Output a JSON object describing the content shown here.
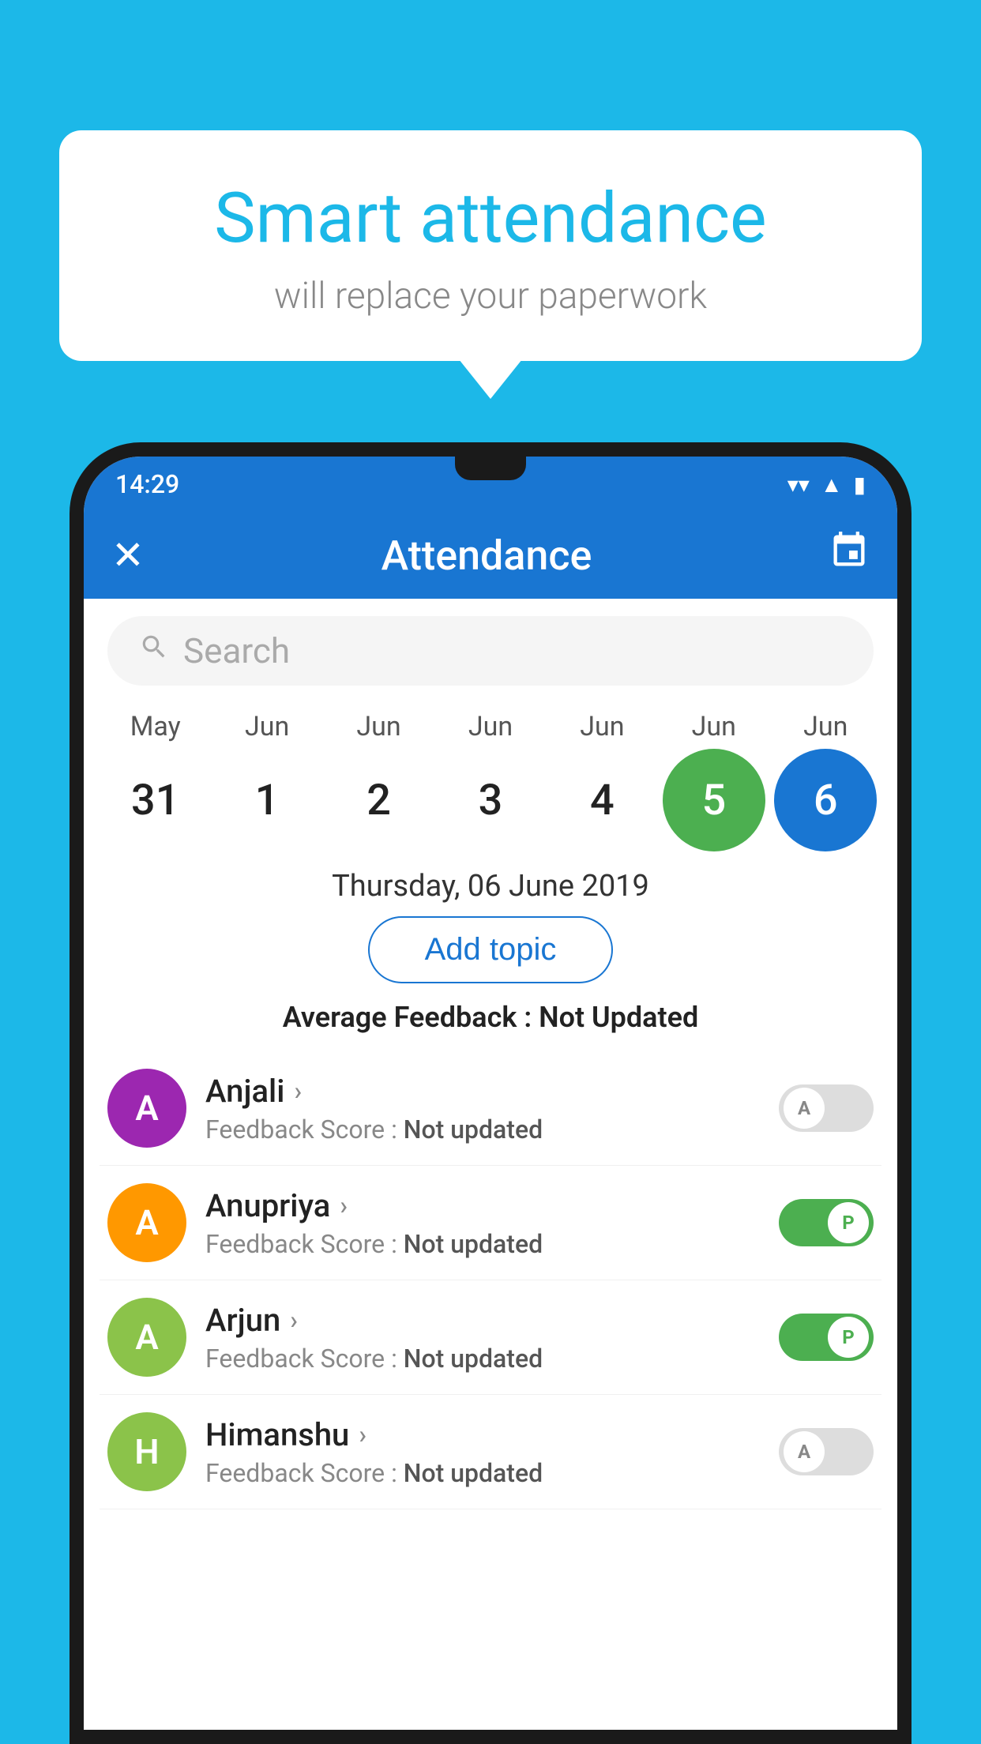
{
  "background_color": "#1cb8e8",
  "bubble": {
    "title": "Smart attendance",
    "subtitle": "will replace your paperwork"
  },
  "status_bar": {
    "time": "14:29",
    "wifi_icon": "▲",
    "signal_icon": "▲",
    "battery_icon": "▮"
  },
  "app_bar": {
    "close_icon": "✕",
    "title": "Attendance",
    "calendar_icon": "📅"
  },
  "search": {
    "placeholder": "Search",
    "icon": "🔍"
  },
  "calendar": {
    "months": [
      "May",
      "Jun",
      "Jun",
      "Jun",
      "Jun",
      "Jun",
      "Jun"
    ],
    "dates": [
      "31",
      "1",
      "2",
      "3",
      "4",
      "5",
      "6"
    ],
    "today_index": 5,
    "selected_index": 6
  },
  "selected_date_label": "Thursday, 06 June 2019",
  "add_topic_label": "Add topic",
  "feedback_summary": {
    "label": "Average Feedback : ",
    "value": "Not Updated"
  },
  "students": [
    {
      "name": "Anjali",
      "avatar_letter": "A",
      "avatar_color": "#9c27b0",
      "feedback_label": "Feedback Score : ",
      "feedback_value": "Not updated",
      "toggle_state": "off",
      "toggle_label": "A"
    },
    {
      "name": "Anupriya",
      "avatar_letter": "A",
      "avatar_color": "#ff9800",
      "feedback_label": "Feedback Score : ",
      "feedback_value": "Not updated",
      "toggle_state": "on",
      "toggle_label": "P"
    },
    {
      "name": "Arjun",
      "avatar_letter": "A",
      "avatar_color": "#8bc34a",
      "feedback_label": "Feedback Score : ",
      "feedback_value": "Not updated",
      "toggle_state": "on",
      "toggle_label": "P"
    },
    {
      "name": "Himanshu",
      "avatar_letter": "H",
      "avatar_color": "#8bc34a",
      "feedback_label": "Feedback Score : ",
      "feedback_value": "Not updated",
      "toggle_state": "off",
      "toggle_label": "A"
    }
  ]
}
